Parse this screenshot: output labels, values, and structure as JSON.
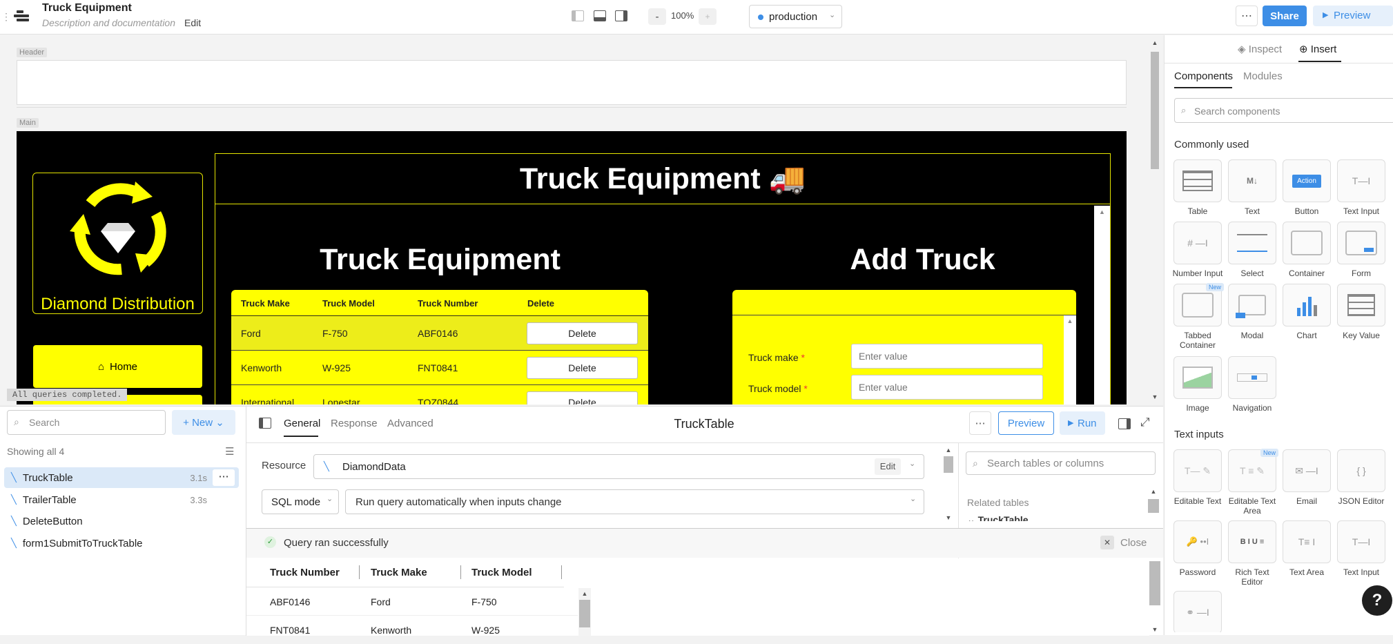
{
  "topbar": {
    "app_title": "Truck Equipment",
    "description": "Description and documentation",
    "edit_label": "Edit",
    "zoom_minus": "-",
    "zoom": "100%",
    "zoom_plus": "+",
    "environment": "production",
    "share_label": "Share",
    "preview_label": "Preview"
  },
  "canvas": {
    "header_tag": "Header",
    "main_tag": "Main",
    "status_text": "All queries completed.",
    "app": {
      "banner_title": "Truck Equipment 🚚",
      "logo_text": "Diamond Distribution",
      "nav_home": "Home",
      "left_title": "Truck Equipment",
      "right_title": "Add Truck",
      "table_headers": [
        "Truck Make",
        "Truck Model",
        "Truck Number",
        "Delete"
      ],
      "rows": [
        {
          "make": "Ford",
          "model": "F-750",
          "number": "ABF0146",
          "action": "Delete"
        },
        {
          "make": "Kenworth",
          "model": "W-925",
          "number": "FNT0841",
          "action": "Delete"
        },
        {
          "make": "International",
          "model": "Lonestar",
          "number": "TQZ0844",
          "action": "Delete"
        }
      ],
      "form": {
        "make_label": "Truck make",
        "model_label": "Truck model",
        "required_mark": "*",
        "placeholder": "Enter value"
      }
    }
  },
  "queries": {
    "search_placeholder": "Search",
    "new_label": "New",
    "showing": "Showing all 4",
    "items": [
      {
        "name": "TruckTable",
        "time": "3.1s"
      },
      {
        "name": "TrailerTable",
        "time": "3.3s"
      },
      {
        "name": "DeleteButton",
        "time": ""
      },
      {
        "name": "form1SubmitToTruckTable",
        "time": ""
      }
    ]
  },
  "editor": {
    "tabs": [
      "General",
      "Response",
      "Advanced"
    ],
    "query_name": "TruckTable",
    "preview_label": "Preview",
    "run_label": "Run",
    "resource_label": "Resource",
    "resource_value": "DiamondData",
    "resource_edit": "Edit",
    "mode_value": "SQL mode",
    "trigger_value": "Run query automatically when inputs change",
    "success_text": "Query ran successfully",
    "close_label": "Close",
    "results_headers": [
      "Truck Number",
      "Truck Make",
      "Truck Model"
    ],
    "results_rows": [
      [
        "ABF0146",
        "Ford",
        "F-750"
      ],
      [
        "FNT0841",
        "Kenworth",
        "W-925"
      ]
    ],
    "schema_search_placeholder": "Search tables or columns",
    "related_tables": "Related tables",
    "related_table_item": "TruckTable"
  },
  "rightpanel": {
    "inspect_label": "Inspect",
    "insert_label": "Insert",
    "tab_components": "Components",
    "tab_modules": "Modules",
    "search_placeholder": "Search components",
    "section_common": "Commonly used",
    "section_text": "Text inputs",
    "button_preview": "Action",
    "new_badge": "New",
    "common": [
      "Table",
      "Text",
      "Button",
      "Text Input",
      "Number Input",
      "Select",
      "Container",
      "Form",
      "Tabbed Container",
      "Modal",
      "Chart",
      "Key Value",
      "Image",
      "Navigation"
    ],
    "text_inputs": [
      "Editable Text",
      "Editable Text Area",
      "Email",
      "JSON Editor",
      "Password",
      "Rich Text Editor",
      "Text Area",
      "Text Input"
    ]
  },
  "colors": {
    "accent": "#3d8ee6",
    "yellow": "#ffff00",
    "app_bg": "#000000"
  }
}
